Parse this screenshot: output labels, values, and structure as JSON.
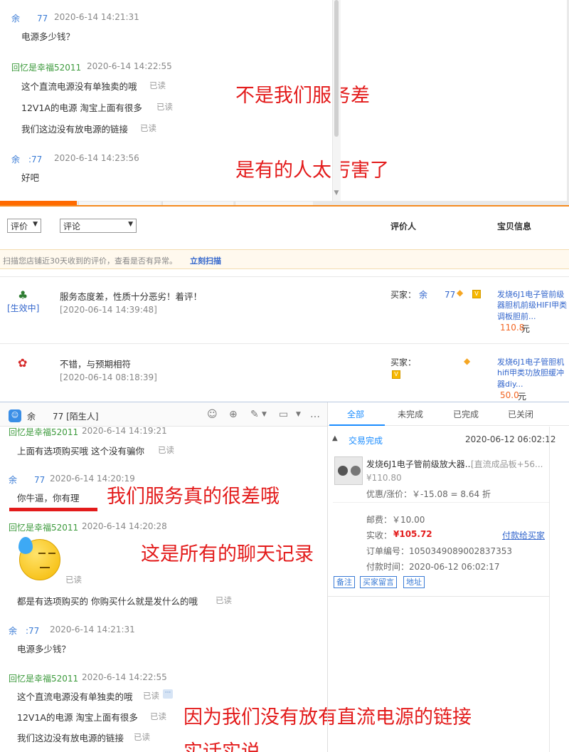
{
  "top_chat": {
    "messages": [
      {
        "name": "余　　77",
        "time": "2020-6-14 14:21:31",
        "lines": [
          {
            "text": "电源多少钱？",
            "read": ""
          }
        ]
      },
      {
        "name": "回忆是幸福52011",
        "time": "2020-6-14 14:22:55",
        "lines": [
          {
            "text": "这个直流电源没有单独卖的哦",
            "read": "已读"
          },
          {
            "text": "12V1A的电源  淘宝上面有很多",
            "read": "已读"
          },
          {
            "text": "我们这边没有放电源的链接",
            "read": "已读"
          }
        ]
      },
      {
        "name": "余　:77",
        "time": "2020-6-14 14:23:56",
        "lines": [
          {
            "text": "好吧",
            "read": ""
          }
        ]
      }
    ],
    "annotations": [
      "不是我们服务差",
      "是有的人太厉害了"
    ]
  },
  "reviews": {
    "filter1": "评价",
    "filter2": "评论",
    "col_reviewer": "评价人",
    "col_item": "宝贝信息",
    "scan_text": "扫描您店铺近30天收到的评价，查看是否有异常。",
    "scan_link": "立刻扫描",
    "rows": [
      {
        "status": "[生效中]",
        "content": "服务态度差，性质十分恶劣！着评！",
        "date": "[2020-06-14 14:39:48]",
        "buyer_label": "买家：",
        "buyer_name": "余　　77",
        "item_lines": [
          "发烧6J1电子管前级",
          "器胆机前级HIFI甲类",
          "调板胆前..."
        ],
        "price": "110.8",
        "unit": "元"
      },
      {
        "status": "",
        "content": "不错，与预期相符",
        "date": "[2020-06-14 08:18:39]",
        "buyer_label": "买家：",
        "buyer_name": "",
        "item_lines": [
          "发烧6J1电子管胆机",
          "hifi甲类功放胆缓冲",
          "器diy..."
        ],
        "price": "50.0",
        "unit": "元"
      }
    ]
  },
  "chat2": {
    "header_name": "余　　77 [陌生人]",
    "messages": [
      {
        "name": "回忆是幸福52011",
        "time": "2020-6-14 14:19:21",
        "lines": [
          {
            "text": "上面有选项购买哦  这个没有骗你",
            "read": "已读"
          }
        ]
      },
      {
        "name": "余　　77",
        "time": "2020-6-14 14:20:19",
        "lines": [
          {
            "text": "你牛逼，你有理",
            "read": ""
          }
        ]
      },
      {
        "name": "回忆是幸福52011",
        "time": "2020-6-14 14:20:28",
        "lines": [
          {
            "text": "",
            "read": "已读"
          },
          {
            "text": "都是有选项购买的  你购买什么就是发什么的哦",
            "read": "已读"
          }
        ]
      },
      {
        "name": "余　:77",
        "time": "2020-6-14 14:21:31",
        "lines": [
          {
            "text": "电源多少钱？",
            "read": ""
          }
        ]
      },
      {
        "name": "回忆是幸福52011",
        "time": "2020-6-14 14:22:55",
        "lines": [
          {
            "text": "这个直流电源没有单独卖的哦",
            "read": "已读"
          },
          {
            "text": "12V1A的电源  淘宝上面有很多",
            "read": "已读"
          },
          {
            "text": "我们这边没有放电源的链接",
            "read": "已读"
          }
        ]
      }
    ],
    "annotations": [
      "我们服务真的很差哦",
      "这是所有的聊天记录",
      "因为我们没有放有直流电源的链接",
      "实话实说"
    ]
  },
  "orders": {
    "tabs": [
      "全部",
      "未完成",
      "已完成",
      "已关闭"
    ],
    "status": "交易完成",
    "datetime": "2020-06-12 06:02:12",
    "item_title": "发烧6J1电子管前级放大器...",
    "item_spec": "[直流成品板+56...",
    "item_price": "¥110.80",
    "discount": "优惠/涨价：￥-15.08 = 8.64 折",
    "postage": "邮费：￥10.00",
    "paid_label": "实收：",
    "paid_value": "¥105.72",
    "pay_link": "付款给买家",
    "order_no": "订单编号：1050349089002837353",
    "pay_time": "付款时间：2020-06-12 06:02:17",
    "buttons": [
      "备注",
      "买家留言",
      "地址"
    ]
  },
  "colors": {
    "accent_red": "#e31b1b",
    "link_blue": "#3366cc",
    "orange": "#f26522",
    "green": "#3c9a3c"
  }
}
